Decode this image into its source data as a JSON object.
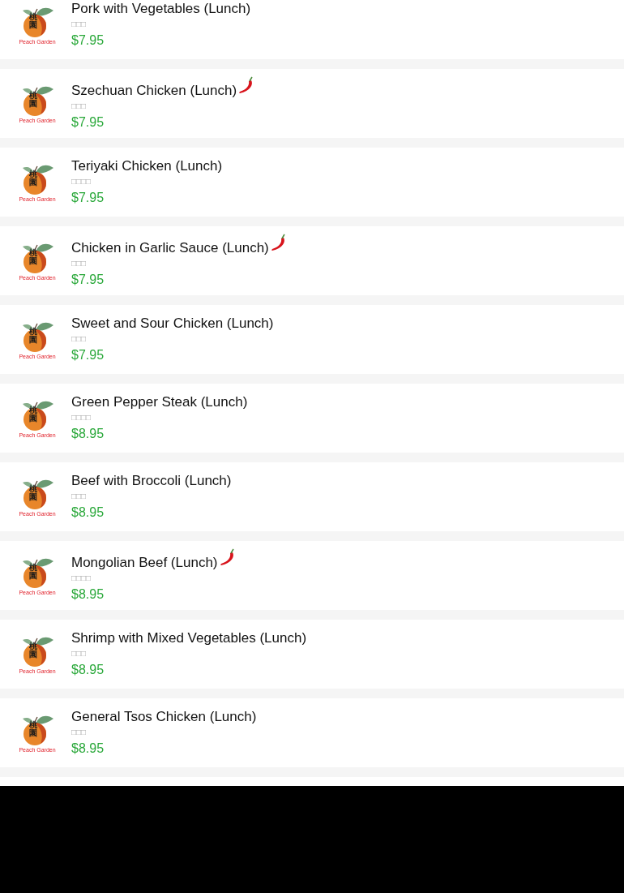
{
  "items": [
    {
      "name": "Pork with Vegetables (Lunch)",
      "subtitle": "□□□",
      "price": "$7.95",
      "spicy": false,
      "logo": {
        "chars": "桃園",
        "caption": "Peach Garden"
      }
    },
    {
      "name": "Szechuan Chicken (Lunch)",
      "subtitle": "□□□",
      "price": "$7.95",
      "spicy": true,
      "logo": {
        "chars": "桃園",
        "caption": "Peach Garden"
      }
    },
    {
      "name": "Teriyaki Chicken (Lunch)",
      "subtitle": "□□□□",
      "price": "$7.95",
      "spicy": false,
      "logo": {
        "chars": "桃園",
        "caption": "Peach Garden"
      }
    },
    {
      "name": "Chicken in Garlic Sauce (Lunch)",
      "subtitle": "□□□",
      "price": "$7.95",
      "spicy": true,
      "logo": {
        "chars": "桃園",
        "caption": "Peach Garden"
      }
    },
    {
      "name": "Sweet and Sour Chicken (Lunch)",
      "subtitle": "□□□",
      "price": "$7.95",
      "spicy": false,
      "logo": {
        "chars": "桃園",
        "caption": "Peach Garden"
      }
    },
    {
      "name": "Green Pepper Steak (Lunch)",
      "subtitle": "□□□□",
      "price": "$8.95",
      "spicy": false,
      "logo": {
        "chars": "桃園",
        "caption": "Peach Garden"
      }
    },
    {
      "name": "Beef with Broccoli (Lunch)",
      "subtitle": "□□□",
      "price": "$8.95",
      "spicy": false,
      "logo": {
        "chars": "桃園",
        "caption": "Peach Garden"
      }
    },
    {
      "name": "Mongolian Beef (Lunch)",
      "subtitle": "□□□□",
      "price": "$8.95",
      "spicy": true,
      "logo": {
        "chars": "桃園",
        "caption": "Peach Garden"
      }
    },
    {
      "name": "Shrimp with Mixed Vegetables (Lunch)",
      "subtitle": "□□□",
      "price": "$8.95",
      "spicy": false,
      "logo": {
        "chars": "桃園",
        "caption": "Peach Garden"
      }
    },
    {
      "name": "General Tsos Chicken (Lunch)",
      "subtitle": "□□□",
      "price": "$8.95",
      "spicy": false,
      "logo": {
        "chars": "桃園",
        "caption": "Peach Garden"
      }
    }
  ]
}
